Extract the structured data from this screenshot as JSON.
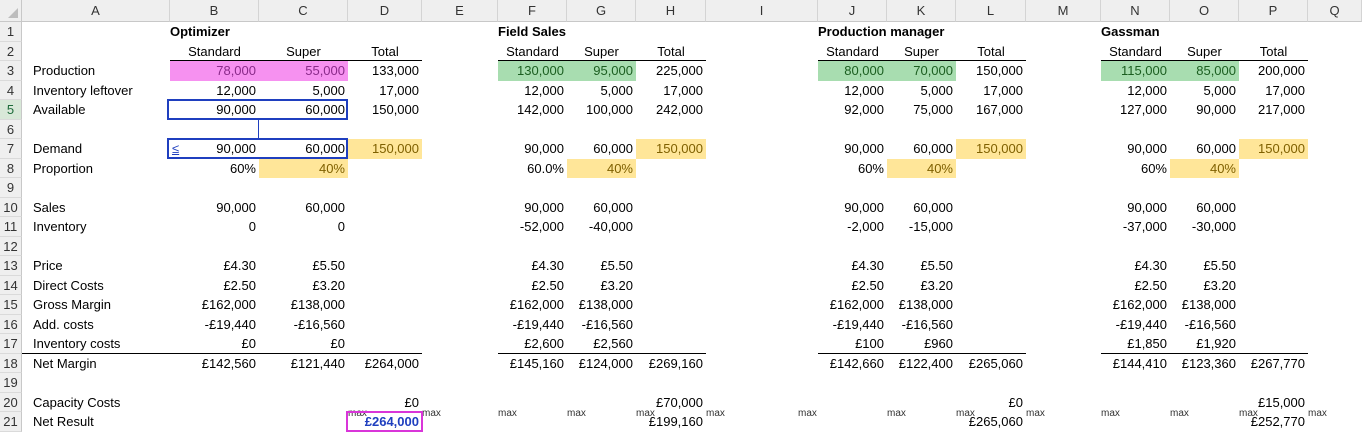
{
  "columns": [
    "A",
    "B",
    "C",
    "D",
    "E",
    "F",
    "G",
    "H",
    "I",
    "J",
    "K",
    "L",
    "M",
    "N",
    "O",
    "P",
    "Q"
  ],
  "rows": [
    "1",
    "2",
    "3",
    "4",
    "5",
    "6",
    "7",
    "8",
    "9",
    "10",
    "11",
    "12",
    "13",
    "14",
    "15",
    "16",
    "17",
    "18",
    "19",
    "20",
    "21"
  ],
  "labels": [
    "Production",
    "Inventory leftover",
    "Available",
    "",
    "Demand",
    "Proportion",
    "",
    "Sales",
    "Inventory",
    "",
    "Price",
    "Direct Costs",
    "Gross Margin",
    "Add. costs",
    "Inventory costs",
    "Net Margin",
    "",
    "Capacity Costs",
    "Net Result"
  ],
  "blocks": [
    {
      "title": "Optimizer",
      "h_std": "Standard",
      "h_sup": "Super",
      "h_tot": "Total",
      "prod": [
        "78,000",
        "55,000",
        "133,000"
      ],
      "inv": [
        "12,000",
        "5,000",
        "17,000"
      ],
      "avail": [
        "90,000",
        "60,000",
        "150,000"
      ],
      "demand": [
        "90,000",
        "60,000",
        "150,000"
      ],
      "prop": [
        "60%",
        "40%"
      ],
      "sales": [
        "90,000",
        "60,000"
      ],
      "inventory": [
        "0",
        "0"
      ],
      "price": [
        "£4.30",
        "£5.50"
      ],
      "direct": [
        "£2.50",
        "£3.20"
      ],
      "gross": [
        "£162,000",
        "£138,000"
      ],
      "add": [
        "-£19,440",
        "-£16,560"
      ],
      "invc": [
        "£0",
        "£0"
      ],
      "net": [
        "£142,560",
        "£121,440",
        "£264,000"
      ],
      "capacity": "£0",
      "result": "£264,000"
    },
    {
      "title": "Field Sales",
      "h_std": "Standard",
      "h_sup": "Super",
      "h_tot": "Total",
      "prod": [
        "130,000",
        "95,000",
        "225,000"
      ],
      "inv": [
        "12,000",
        "5,000",
        "17,000"
      ],
      "avail": [
        "142,000",
        "100,000",
        "242,000"
      ],
      "demand": [
        "90,000",
        "60,000",
        "150,000"
      ],
      "prop": [
        "60.0%",
        "40%"
      ],
      "sales": [
        "90,000",
        "60,000"
      ],
      "inventory": [
        "-52,000",
        "-40,000"
      ],
      "price": [
        "£4.30",
        "£5.50"
      ],
      "direct": [
        "£2.50",
        "£3.20"
      ],
      "gross": [
        "£162,000",
        "£138,000"
      ],
      "add": [
        "-£19,440",
        "-£16,560"
      ],
      "invc": [
        "£2,600",
        "£2,560"
      ],
      "net": [
        "£145,160",
        "£124,000",
        "£269,160"
      ],
      "capacity": "£70,000",
      "result": "£199,160"
    },
    {
      "title": "Production manager",
      "h_std": "Standard",
      "h_sup": "Super",
      "h_tot": "Total",
      "prod": [
        "80,000",
        "70,000",
        "150,000"
      ],
      "inv": [
        "12,000",
        "5,000",
        "17,000"
      ],
      "avail": [
        "92,000",
        "75,000",
        "167,000"
      ],
      "demand": [
        "90,000",
        "60,000",
        "150,000"
      ],
      "prop": [
        "60%",
        "40%"
      ],
      "sales": [
        "90,000",
        "60,000"
      ],
      "inventory": [
        "-2,000",
        "-15,000"
      ],
      "price": [
        "£4.30",
        "£5.50"
      ],
      "direct": [
        "£2.50",
        "£3.20"
      ],
      "gross": [
        "£162,000",
        "£138,000"
      ],
      "add": [
        "-£19,440",
        "-£16,560"
      ],
      "invc": [
        "£100",
        "£960"
      ],
      "net": [
        "£142,660",
        "£122,400",
        "£265,060"
      ],
      "capacity": "£0",
      "result": "£265,060"
    },
    {
      "title": "Gassman",
      "h_std": "Standard",
      "h_sup": "Super",
      "h_tot": "Total",
      "prod": [
        "115,000",
        "85,000",
        "200,000"
      ],
      "inv": [
        "12,000",
        "5,000",
        "17,000"
      ],
      "avail": [
        "127,000",
        "90,000",
        "217,000"
      ],
      "demand": [
        "90,000",
        "60,000",
        "150,000"
      ],
      "prop": [
        "60%",
        "40%"
      ],
      "sales": [
        "90,000",
        "60,000"
      ],
      "inventory": [
        "-37,000",
        "-30,000"
      ],
      "price": [
        "£4.30",
        "£5.50"
      ],
      "direct": [
        "£2.50",
        "£3.20"
      ],
      "gross": [
        "£162,000",
        "£138,000"
      ],
      "add": [
        "-£19,440",
        "-£16,560"
      ],
      "invc": [
        "£1,850",
        "£1,920"
      ],
      "net": [
        "£144,410",
        "£123,360",
        "£267,770"
      ],
      "capacity": "£15,000",
      "result": "£252,770"
    }
  ],
  "le_symbol": "≤",
  "max_label": "max",
  "colors": {
    "pink": "#f691f0",
    "green": "#a8ddb0",
    "yellow": "#ffe699",
    "blue_box": "#1f3fbf",
    "magenta_box": "#d935d9"
  }
}
